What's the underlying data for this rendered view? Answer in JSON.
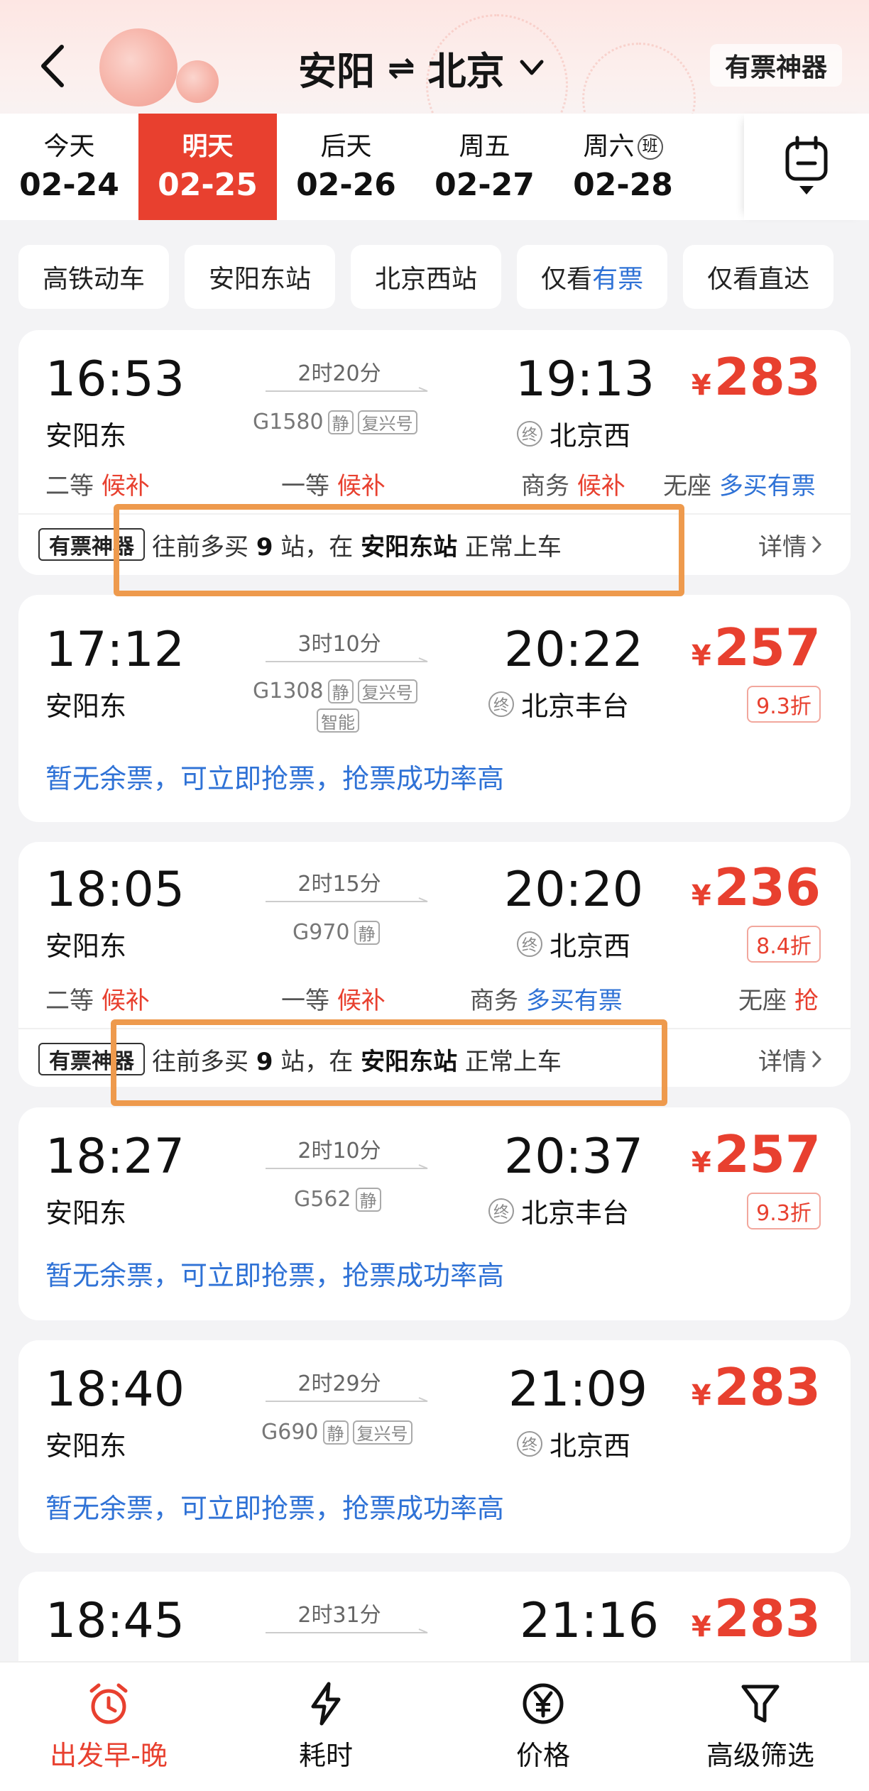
{
  "header": {
    "from": "安阳",
    "swap_symbol": "⇌",
    "to": "北京",
    "brand": "有票神器"
  },
  "dates": [
    {
      "weekday": "今天",
      "date": "02-24",
      "active": false
    },
    {
      "weekday": "明天",
      "date": "02-25",
      "active": true
    },
    {
      "weekday": "后天",
      "date": "02-26",
      "active": false
    },
    {
      "weekday": "周五",
      "date": "02-27",
      "active": false
    },
    {
      "weekday": "周六",
      "badge": "班",
      "date": "02-28",
      "active": false
    }
  ],
  "filters": [
    {
      "label": "高铁动车"
    },
    {
      "label": "安阳东站"
    },
    {
      "label": "北京西站"
    },
    {
      "label_prefix": "仅看",
      "label_highlight": "有票"
    },
    {
      "label": "仅看直达"
    }
  ],
  "trains": [
    {
      "dep_time": "16:53",
      "dep_station": "安阳东",
      "duration": "2时20分",
      "number": "G1580",
      "tags": [
        "静",
        "复兴号"
      ],
      "arr_time": "19:13",
      "term_tag": "终",
      "arr_station": "北京西",
      "currency": "¥",
      "price": "283",
      "seats": [
        {
          "name": "二等",
          "status": "候补"
        },
        {
          "name": "一等",
          "status": "候补"
        },
        {
          "name": "商务",
          "status": "候补"
        },
        {
          "name": "无座",
          "status": "多买有票"
        }
      ],
      "tip": {
        "logo": "有票神器",
        "pre": "往前多买",
        "count": "9",
        "mid": "站，在",
        "station": "安阳东站",
        "post": "正常上车",
        "detail": "详情"
      }
    },
    {
      "dep_time": "17:12",
      "dep_station": "安阳东",
      "duration": "3时10分",
      "number": "G1308",
      "tags": [
        "静",
        "复兴号"
      ],
      "tag2": "智能",
      "arr_time": "20:22",
      "term_tag": "终",
      "arr_station": "北京丰台",
      "currency": "¥",
      "price": "257",
      "discount": "9.3折",
      "promo": "暂无余票，可立即抢票，抢票成功率高"
    },
    {
      "dep_time": "18:05",
      "dep_station": "安阳东",
      "duration": "2时15分",
      "number": "G970",
      "tags": [
        "静"
      ],
      "arr_time": "20:20",
      "term_tag": "终",
      "arr_station": "北京西",
      "currency": "¥",
      "price": "236",
      "discount": "8.4折",
      "seats": [
        {
          "name": "二等",
          "status": "候补"
        },
        {
          "name": "一等",
          "status": "候补"
        },
        {
          "name": "商务",
          "status": "多买有票"
        },
        {
          "name": "无座",
          "status": "抢"
        }
      ],
      "tip": {
        "logo": "有票神器",
        "pre": "往前多买",
        "count": "9",
        "mid": "站，在",
        "station": "安阳东站",
        "post": "正常上车",
        "detail": "详情"
      }
    },
    {
      "dep_time": "18:27",
      "dep_station": "安阳东",
      "duration": "2时10分",
      "number": "G562",
      "tags": [
        "静"
      ],
      "arr_time": "20:37",
      "term_tag": "终",
      "arr_station": "北京丰台",
      "currency": "¥",
      "price": "257",
      "discount": "9.3折",
      "promo": "暂无余票，可立即抢票，抢票成功率高"
    },
    {
      "dep_time": "18:40",
      "dep_station": "安阳东",
      "duration": "2时29分",
      "number": "G690",
      "tags": [
        "静",
        "复兴号"
      ],
      "arr_time": "21:09",
      "term_tag": "终",
      "arr_station": "北京西",
      "currency": "¥",
      "price": "283",
      "promo": "暂无余票，可立即抢票，抢票成功率高"
    },
    {
      "dep_time": "18:45",
      "duration": "2时31分",
      "arr_time": "21:16",
      "currency": "¥",
      "price": "283"
    }
  ],
  "bottom_nav": [
    {
      "label": "出发早-晚",
      "icon": "alarm-clock-icon",
      "active": true
    },
    {
      "label": "耗时",
      "icon": "lightning-icon",
      "active": false
    },
    {
      "label": "价格",
      "icon": "yen-icon",
      "active": false
    },
    {
      "label": "高级筛选",
      "icon": "filter-icon",
      "active": false
    }
  ],
  "colors": {
    "accent": "#e8402f",
    "link": "#2f72d6",
    "highlight": "#ee9a4d"
  }
}
